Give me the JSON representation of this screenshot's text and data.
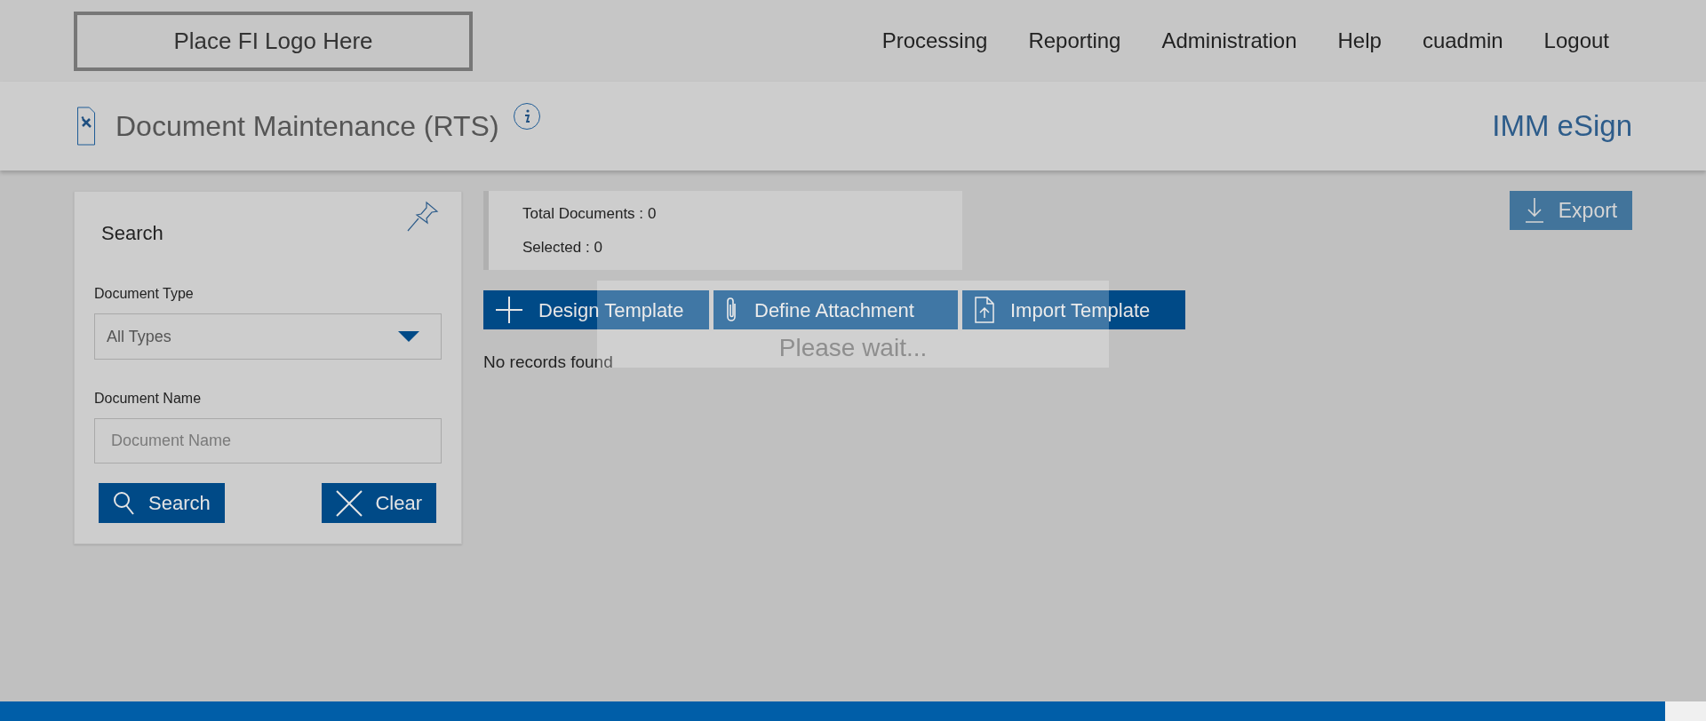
{
  "logo": {
    "label": "Place FI Logo Here"
  },
  "nav": [
    {
      "label": "Processing"
    },
    {
      "label": "Reporting"
    },
    {
      "label": "Administration"
    },
    {
      "label": "Help"
    },
    {
      "label": "cuadmin"
    },
    {
      "label": "Logout"
    }
  ],
  "page_header": {
    "title": "Document Maintenance (RTS)",
    "product": "IMM eSign"
  },
  "search_panel": {
    "title": "Search",
    "fields": [
      {
        "kind": "select",
        "label": "Document Type",
        "value": "All Types"
      },
      {
        "kind": "text",
        "label": "Document Name",
        "placeholder": "Document Name"
      }
    ],
    "buttons": [
      {
        "kind": "search",
        "label": "Search"
      },
      {
        "kind": "clear",
        "label": "Clear"
      }
    ]
  },
  "stats": [
    {
      "label": "Total Documents :",
      "value": "0"
    },
    {
      "label": "Selected :",
      "value": "0"
    }
  ],
  "toolbar": [
    {
      "kind": "plus",
      "label": "Design Template"
    },
    {
      "kind": "paperclip",
      "label": "Define Attachment"
    },
    {
      "kind": "upload",
      "label": "Import Template"
    }
  ],
  "export_button": {
    "label": "Export",
    "disabled": true
  },
  "empty_message": "No records found",
  "loading_overlay": {
    "message": "Please wait..."
  }
}
